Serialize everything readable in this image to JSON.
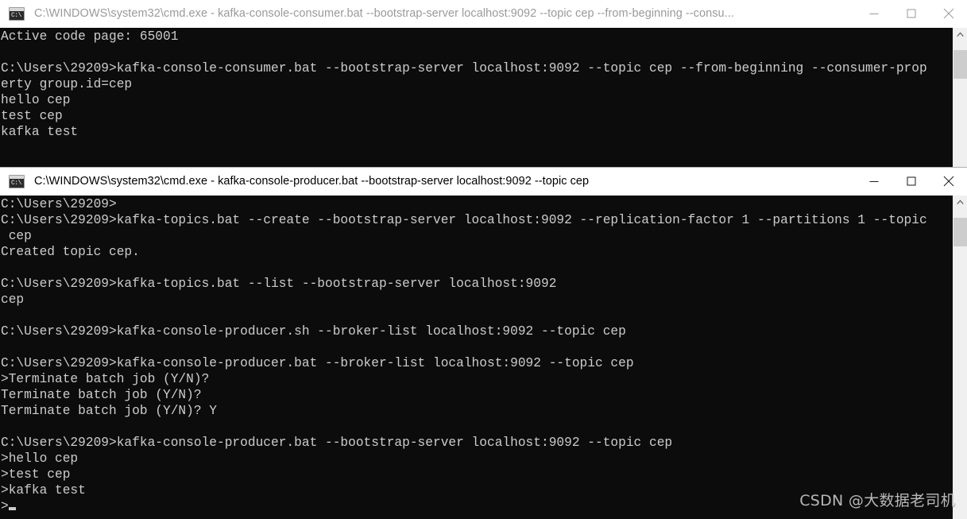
{
  "watermark": "CSDN @大数据老司机",
  "colors": {
    "console_bg": "#0c0c0c",
    "console_fg": "#cccccc",
    "titlebar_bg": "#ffffff",
    "title_active": "#000000",
    "title_inactive": "#9a9a9a",
    "scrollbar_track": "#f0f0f0",
    "scrollbar_thumb": "#cdcdcd"
  },
  "windows": [
    {
      "id": "consumer",
      "state": "inactive",
      "icon": "cmd-icon",
      "icon_glyph": "C:\\",
      "title": "C:\\WINDOWS\\system32\\cmd.exe - kafka-console-consumer.bat  --bootstrap-server localhost:9092 --topic cep --from-beginning --consu...",
      "buttons": {
        "minimize": "minimize-button",
        "maximize": "maximize-button",
        "close": "close-button"
      },
      "scrollbar": {
        "visible": true,
        "arrow": "scroll-up-arrow"
      },
      "lines": [
        "Active code page: 65001",
        "",
        "C:\\Users\\29209>kafka-console-consumer.bat --bootstrap-server localhost:9092 --topic cep --from-beginning --consumer-prop",
        "erty group.id=cep",
        "hello cep",
        "test cep",
        "kafka test"
      ]
    },
    {
      "id": "producer",
      "state": "active",
      "icon": "cmd-icon",
      "icon_glyph": "C:\\",
      "title": "C:\\WINDOWS\\system32\\cmd.exe - kafka-console-producer.bat  --bootstrap-server localhost:9092 --topic cep",
      "buttons": {
        "minimize": "minimize-button",
        "maximize": "maximize-button",
        "close": "close-button"
      },
      "scrollbar": {
        "visible": true,
        "arrow": "scroll-up-arrow"
      },
      "lines": [
        "C:\\Users\\29209>",
        "C:\\Users\\29209>kafka-topics.bat --create --bootstrap-server localhost:9092 --replication-factor 1 --partitions 1 --topic",
        " cep",
        "Created topic cep.",
        "",
        "C:\\Users\\29209>kafka-topics.bat --list --bootstrap-server localhost:9092",
        "cep",
        "",
        "C:\\Users\\29209>kafka-console-producer.sh --broker-list localhost:9092 --topic cep",
        "",
        "C:\\Users\\29209>kafka-console-producer.bat --broker-list localhost:9092 --topic cep",
        ">Terminate batch job (Y/N)?",
        "Terminate batch job (Y/N)?",
        "Terminate batch job (Y/N)? Y",
        "",
        "C:\\Users\\29209>kafka-console-producer.bat --bootstrap-server localhost:9092 --topic cep",
        ">hello cep",
        ">test cep",
        ">kafka test",
        ">"
      ],
      "cursor_on_last_line": true
    }
  ]
}
